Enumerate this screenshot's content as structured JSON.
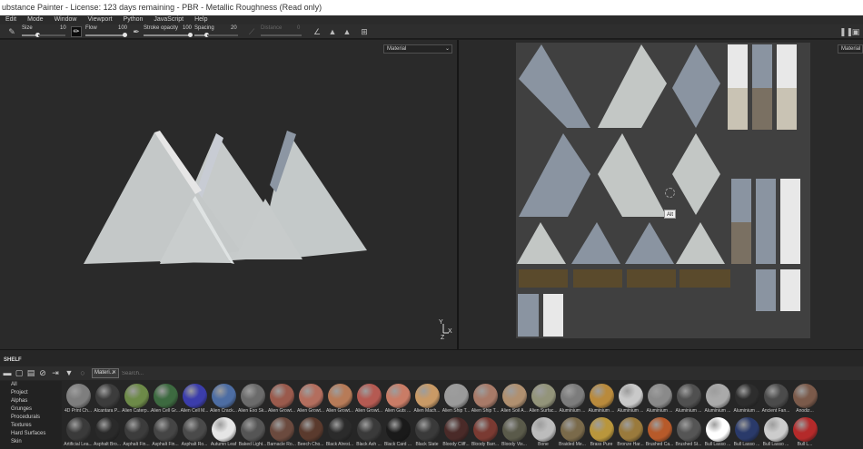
{
  "window": {
    "title": "ubstance Painter - License: 123 days remaining - PBR - Metallic Roughness (Read only)"
  },
  "menu": [
    "Edit",
    "Mode",
    "Window",
    "Viewport",
    "Python",
    "JavaScript",
    "Help"
  ],
  "toolbar": {
    "size_label": "Size",
    "size_value": "10",
    "flow_label": "Flow",
    "flow_value": "100",
    "stroke_opacity_label": "Stroke opacity",
    "stroke_opacity_value": "100",
    "spacing_label": "Spacing",
    "spacing_value": "20",
    "distance_label": "Distance",
    "distance_value": "0",
    "brush_icon": "brush-icon"
  },
  "viewport3d": {
    "mode": "Material"
  },
  "viewport2d": {
    "mode": "Material",
    "cursor_tooltip": "Alt"
  },
  "shelf": {
    "title": "SHELF",
    "filter_chip": "Materi...",
    "search_placeholder": "Search...",
    "categories": [
      "All",
      "Project",
      "Alphas",
      "Grunges",
      "Procedurals",
      "Textures",
      "Hard Surfaces",
      "Skin"
    ],
    "row1": [
      "4D Print Ch...",
      "Alcantara P...",
      "Alien Caterp...",
      "Alien Cell Gr...",
      "Alien Cell M...",
      "Alien Crack...",
      "Alien Exo Sk...",
      "Alien Growt...",
      "Alien Growt...",
      "Alien Growt...",
      "Alien Growt...",
      "Alien Guts ...",
      "Alien Mach...",
      "Alien Ship T...",
      "Alien Ship T...",
      "Alien Soil A...",
      "Alien Surfac...",
      "Aluminium ...",
      "Aluminium ...",
      "Aluminium ...",
      "Aluminium ...",
      "Aluminium ...",
      "Aluminium ...",
      "Aluminium ...",
      "Ancient Fan...",
      "Anodiz..."
    ],
    "row2": [
      "Artificial Lea...",
      "Asphalt Bro...",
      "Asphalt Fin...",
      "Asphalt Fin...",
      "Asphalt Ro...",
      "Autumn Leaf",
      "Baked Light...",
      "Barnacle Ro...",
      "Beech Cho...",
      "Black Alrest...",
      "Black Ash ...",
      "Black Card ...",
      "Black Slate",
      "Bloody Cliff...",
      "Bloody Barr...",
      "Bloody Vis...",
      "Bone",
      "Braided Me...",
      "Brass Pure",
      "Bronze Har...",
      "Brushed Ca...",
      "Brushed St...",
      "Bull Lasso ...",
      "Bull Lasso ...",
      "Bull Lasso ...",
      "Bull L..."
    ],
    "colors_row1": [
      "#7e7e7e",
      "#3c3c3c",
      "#6d8a48",
      "#3d6a40",
      "#3b3dab",
      "#4d6da3",
      "#6b6b6b",
      "#9a5a4c",
      "#b36e5e",
      "#b77b58",
      "#b55a52",
      "#c97c66",
      "#c99a66",
      "#9a9a9a",
      "#a87a68",
      "#b09070",
      "#93947a",
      "#7c7c7c",
      "#b98a3c",
      "#c9c9c9",
      "#8a8a8a",
      "#505050",
      "#aaaaaa",
      "#2d2d2d",
      "#4b4b4b",
      "#7b5a4a",
      "#6a9aaa"
    ],
    "colors_row2": [
      "#3a3a3a",
      "#2a2a2a",
      "#3c3c3c",
      "#454545",
      "#4a4a4a",
      "#e5e5e5",
      "#555555",
      "#6b4a3e",
      "#5a3a2d",
      "#2b2b2b",
      "#3a3a3a",
      "#1a1a1a",
      "#3a3a3a",
      "#4a2a28",
      "#7a3a32",
      "#5a5a4a",
      "#bcbcbc",
      "#7a6a4a",
      "#b9963c",
      "#9a7a3c",
      "#b75a2a",
      "#555555",
      "#ffffff",
      "#2a3a6a",
      "#cccccc",
      "#b42a2a",
      "#c9c9c9"
    ]
  }
}
